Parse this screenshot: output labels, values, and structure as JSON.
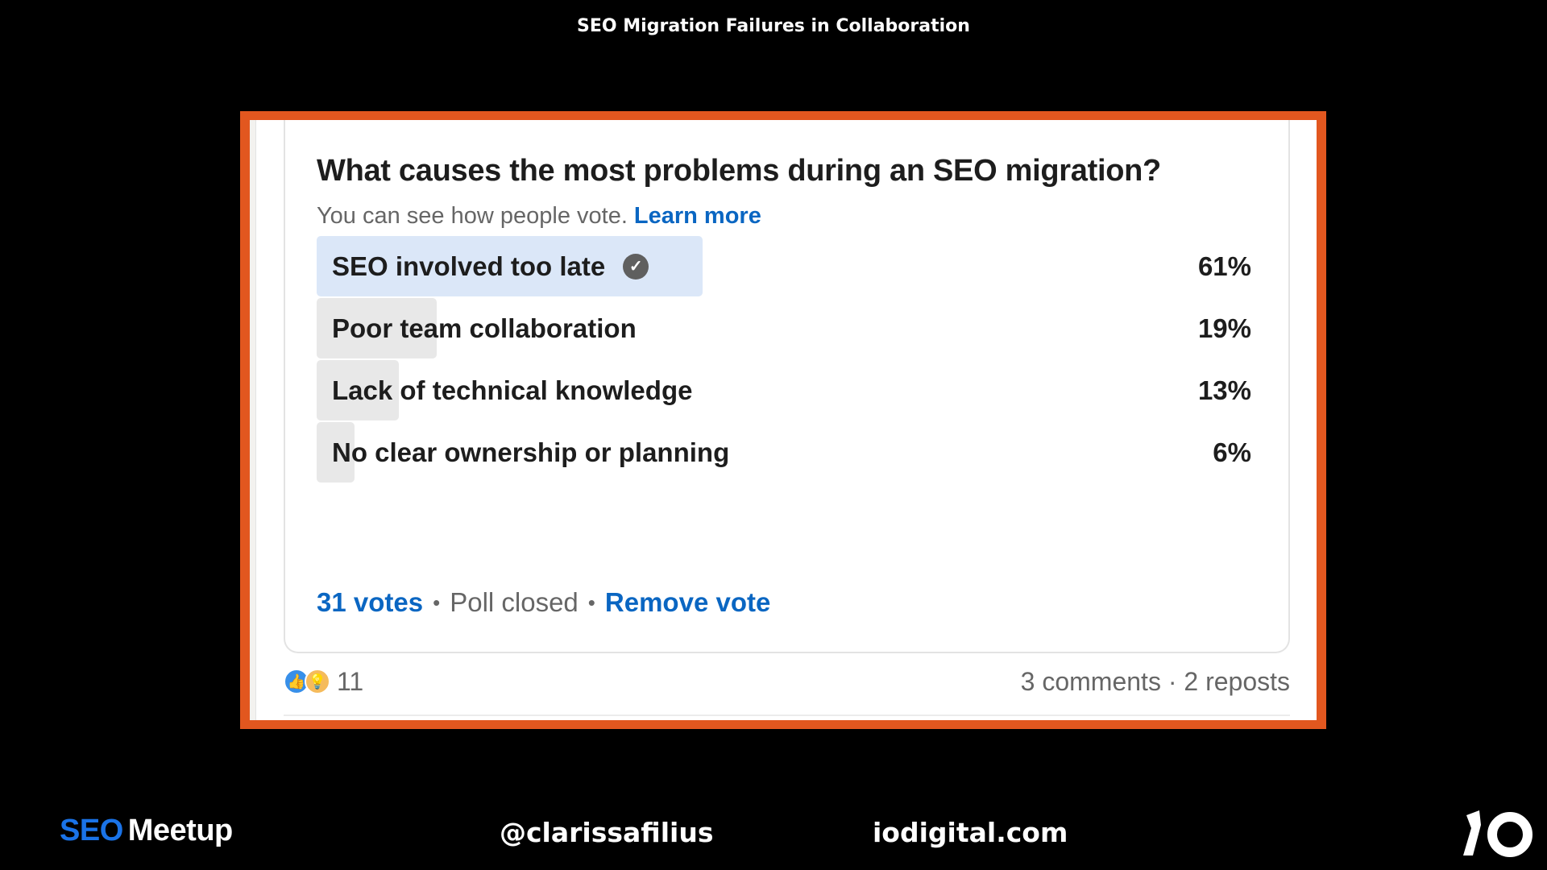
{
  "slide": {
    "title": "SEO Migration Failures in Collaboration"
  },
  "poll": {
    "question": "What causes the most problems during an SEO migration?",
    "subtext": "You can see how people vote.",
    "learn_more": "Learn more",
    "options": [
      {
        "label": "SEO involved too late",
        "percent": "61%",
        "share": 0.61,
        "selected": true
      },
      {
        "label": "Poor team collaboration",
        "percent": "19%",
        "share": 0.19,
        "selected": false
      },
      {
        "label": "Lack of technical knowledge",
        "percent": "13%",
        "share": 0.13,
        "selected": false
      },
      {
        "label": "No clear ownership or planning",
        "percent": "6%",
        "share": 0.06,
        "selected": false
      }
    ],
    "votes": "31 votes",
    "status": "Poll closed",
    "remove_vote": "Remove vote",
    "separator": "•"
  },
  "social": {
    "reaction_count": "11",
    "reaction_icons": [
      "like-icon",
      "insightful-icon"
    ],
    "counts": "3 comments · 2 reposts"
  },
  "footer": {
    "brand_seo": "SEO",
    "brand_meetup": "Meetup",
    "handle": "@clarissafilius",
    "site": "iodigital.com",
    "logo": "io-logo"
  },
  "colors": {
    "frame": "#e2571f",
    "selected_fill": "#dbe7f8",
    "unselected_fill": "#e8e8e8",
    "link": "#0a66c2",
    "brand_blue": "#1a73e8"
  }
}
